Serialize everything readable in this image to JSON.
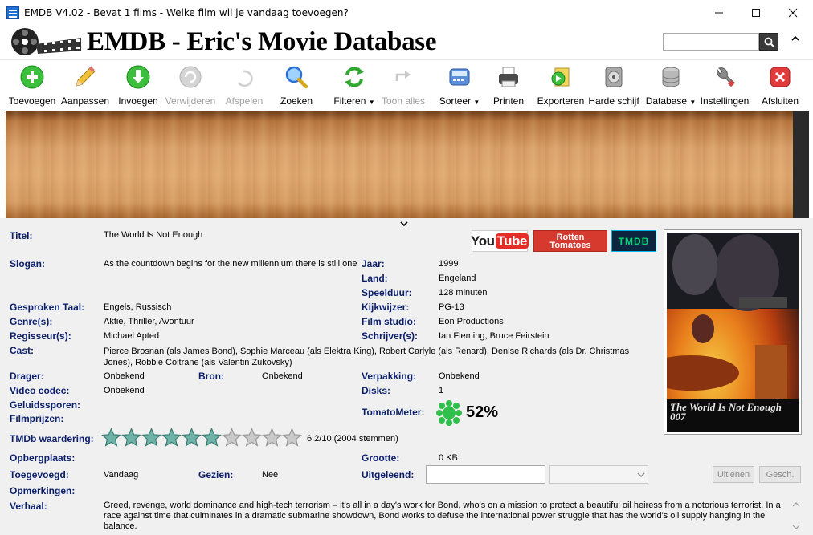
{
  "window": {
    "title": "EMDB V4.02 - Bevat 1 films - Welke film wil je vandaag toevoegen?"
  },
  "header": {
    "app_name": "EMDB - Eric's Movie Database",
    "search_placeholder": ""
  },
  "toolbar": [
    {
      "label": "Toevoegen",
      "icon": "add-icon",
      "enabled": true,
      "dropdown": false
    },
    {
      "label": "Aanpassen",
      "icon": "pencil-icon",
      "enabled": true,
      "dropdown": false
    },
    {
      "label": "Invoegen",
      "icon": "import-icon",
      "enabled": true,
      "dropdown": false
    },
    {
      "label": "Verwijderen",
      "icon": "delete-icon",
      "enabled": false,
      "dropdown": false
    },
    {
      "label": "Afspelen",
      "icon": "play-icon",
      "enabled": false,
      "dropdown": false
    },
    {
      "label": "Zoeken",
      "icon": "magnifier-icon",
      "enabled": true,
      "dropdown": false
    },
    {
      "label": "Filteren",
      "icon": "filter-icon",
      "enabled": true,
      "dropdown": true
    },
    {
      "label": "Toon alles",
      "icon": "show-all-icon",
      "enabled": false,
      "dropdown": false
    },
    {
      "label": "Sorteer",
      "icon": "sort-icon",
      "enabled": true,
      "dropdown": true
    },
    {
      "label": "Printen",
      "icon": "printer-icon",
      "enabled": true,
      "dropdown": false
    },
    {
      "label": "Exporteren",
      "icon": "export-icon",
      "enabled": true,
      "dropdown": false
    },
    {
      "label": "Harde schijf",
      "icon": "harddisk-icon",
      "enabled": true,
      "dropdown": false
    },
    {
      "label": "Database",
      "icon": "database-icon",
      "enabled": true,
      "dropdown": true
    },
    {
      "label": "Instellingen",
      "icon": "wrench-icon",
      "enabled": true,
      "dropdown": false
    },
    {
      "label": "Afsluiten",
      "icon": "close-red-icon",
      "enabled": true,
      "dropdown": false
    }
  ],
  "links": {
    "youtube": "YouTube",
    "rotten": "Rotten Tomatoes",
    "tmdb": "TMDB"
  },
  "poster": {
    "title_text": "The World Is Not Enough 007"
  },
  "movie": {
    "titel_label": "Titel:",
    "titel": "The World Is Not Enough",
    "slogan_label": "Slogan:",
    "slogan": "As the countdown begins for the new millennium there is still one",
    "jaar_label": "Jaar:",
    "jaar": "1999",
    "land_label": "Land:",
    "land": "Engeland",
    "speelduur_label": "Speelduur:",
    "speelduur": "128 minuten",
    "taal_label": "Gesproken Taal:",
    "taal": "Engels, Russisch",
    "kijkwijzer_label": "Kijkwijzer:",
    "kijkwijzer": "PG-13",
    "genre_label": "Genre(s):",
    "genre": "Aktie, Thriller, Avontuur",
    "studio_label": "Film studio:",
    "studio": "Eon Productions",
    "regisseur_label": "Regisseur(s):",
    "regisseur": "Michael Apted",
    "schrijver_label": "Schrijver(s):",
    "schrijver": "Ian Fleming, Bruce Feirstein",
    "cast_label": "Cast:",
    "cast": "Pierce Brosnan  (als James Bond), Sophie Marceau  (als Elektra King), Robert Carlyle  (als Renard), Denise Richards  (als Dr. Christmas Jones), Robbie Coltrane  (als Valentin Zukovsky)",
    "drager_label": "Drager:",
    "drager": "Onbekend",
    "bron_label": "Bron:",
    "bron": "Onbekend",
    "verpakking_label": "Verpakking:",
    "verpakking": "Onbekend",
    "codec_label": "Video codec:",
    "codec": "Onbekend",
    "disks_label": "Disks:",
    "disks": "1",
    "geluid_label": "Geluidssporen:",
    "tomato_label": "TomatoMeter:",
    "tomato": "52%",
    "tomato_score": 52,
    "prijzen_label": "Filmprijzen:",
    "tmdb_label": "TMDb waardering:",
    "tmdb_text": "6.2/10  (2004 stemmen)",
    "tmdb_rating": 6.2,
    "tmdb_max": 10,
    "opberg_label": "Opbergplaats:",
    "grootte_label": "Grootte:",
    "grootte": "0 KB",
    "toegevoegd_label": "Toegevoegd:",
    "toegevoegd": "Vandaag",
    "gezien_label": "Gezien:",
    "gezien": "Nee",
    "uitgeleend_label": "Uitgeleend:",
    "uitgeleend_value": "",
    "opmerkingen_label": "Opmerkingen:",
    "verhaal_label": "Verhaal:",
    "verhaal": "Greed, revenge, world dominance and high-tech terrorism – it's all in a day's work for Bond, who's on a mission to protect a beautiful oil heiress from a notorious terrorist. In a race against time that culminates in a dramatic submarine showdown, Bond works to defuse the international power struggle that has the world's oil supply hanging in the balance."
  },
  "buttons": {
    "uitlenen": "Uitlenen",
    "gesch": "Gesch."
  },
  "colors": {
    "label_blue": "#0b1f6b",
    "star_filled": "#6fb3a8",
    "star_empty": "#9a9a9a",
    "tomato_green": "#2fbf4a",
    "youtube_red": "#e52d27",
    "rotten_red": "#d63a2f",
    "tmdb_dark": "#0d253f",
    "tmdb_accent": "#01b4e4"
  }
}
